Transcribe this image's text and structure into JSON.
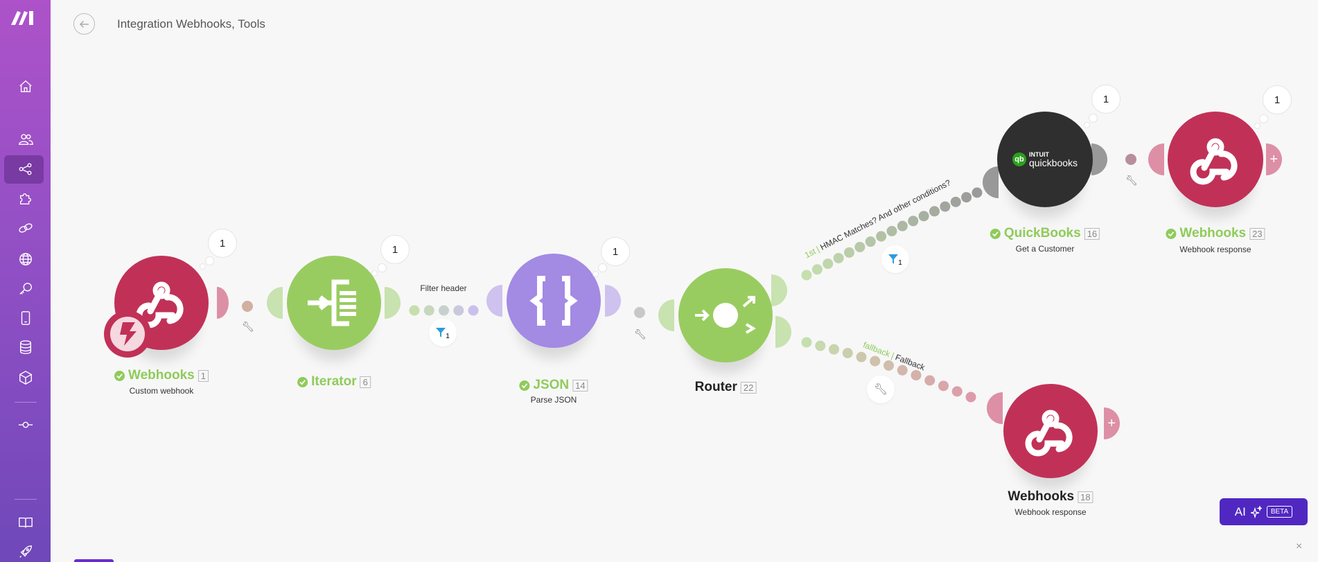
{
  "header": {
    "title": "Integration Webhooks, Tools",
    "back_icon": "arrow-left-icon"
  },
  "sidebar": {
    "items": [
      {
        "name": "home",
        "icon": "home-icon"
      },
      {
        "name": "team",
        "icon": "users-icon"
      },
      {
        "name": "scenarios",
        "icon": "share-nodes-icon",
        "active": true
      },
      {
        "name": "templates",
        "icon": "puzzle-icon"
      },
      {
        "name": "connections",
        "icon": "link-icon"
      },
      {
        "name": "webhooks",
        "icon": "globe-icon"
      },
      {
        "name": "keys",
        "icon": "key-icon"
      },
      {
        "name": "devices",
        "icon": "phone-icon"
      },
      {
        "name": "data-stores",
        "icon": "database-icon"
      },
      {
        "name": "data-structures",
        "icon": "cube-icon"
      },
      {
        "name": "custom-apps",
        "icon": "connector-icon"
      },
      {
        "name": "help",
        "icon": "book-icon"
      },
      {
        "name": "whats-new",
        "icon": "rocket-icon"
      }
    ]
  },
  "colors": {
    "webhooks": "#c13157",
    "iterator": "#99cc60",
    "json": "#a38ae3",
    "router": "#99cc60",
    "quickbooks": "#2f2f30",
    "ok": "#8fcb5a",
    "ai": "#5127c2",
    "filter": "#2d9cdb"
  },
  "modules": {
    "webhooks_trigger": {
      "title": "Webhooks",
      "index": "1",
      "subtitle": "Custom webhook",
      "bubble": "1"
    },
    "iterator": {
      "title": "Iterator",
      "index": "6",
      "bubble": "1"
    },
    "json": {
      "title": "JSON",
      "index": "14",
      "subtitle": "Parse JSON",
      "bubble": "1"
    },
    "router": {
      "title": "Router",
      "index": "22"
    },
    "quickbooks": {
      "title": "QuickBooks",
      "index": "16",
      "subtitle": "Get a Customer",
      "bubble": "1",
      "logo_top": "INTUIT",
      "logo_bottom": "quickbooks"
    },
    "webhooks_response_23": {
      "title": "Webhooks",
      "index": "23",
      "subtitle": "Webhook response",
      "bubble": "1"
    },
    "webhooks_response_18": {
      "title": "Webhooks",
      "index": "18",
      "subtitle": "Webhook response"
    }
  },
  "links": {
    "filter_header": {
      "label": "Filter header",
      "filter_count": "1"
    },
    "route1": {
      "order": "1st",
      "label": "HMAC Matches? And other conditions?",
      "filter_count": "1"
    },
    "fallback": {
      "order": "fallback",
      "label": "Fallback"
    }
  },
  "ai_button": {
    "label": "AI",
    "badge": "BETA"
  },
  "close_label": "×"
}
